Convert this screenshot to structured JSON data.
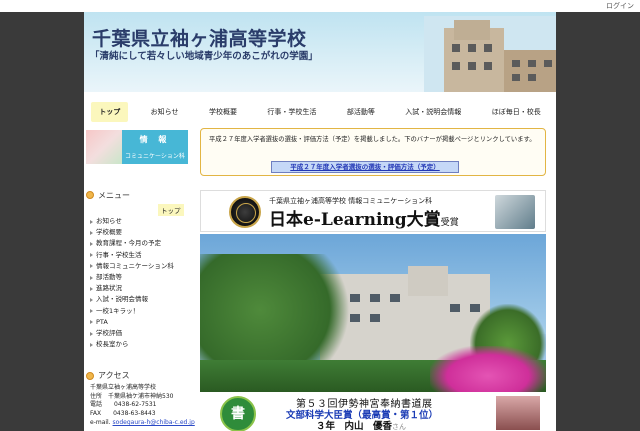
{
  "topbar": {
    "login_label": "ログイン"
  },
  "header": {
    "title": "千葉県立袖ヶ浦高等学校",
    "subtitle": "「清純にして若々しい地域青少年のあこがれの学園」"
  },
  "nav": {
    "items": [
      {
        "label": "トップ",
        "active": true
      },
      {
        "label": "お知らせ"
      },
      {
        "label": "学校概要"
      },
      {
        "label": "行事・学校生活"
      },
      {
        "label": "部活動等"
      },
      {
        "label": "入試・説明会情報"
      },
      {
        "label": "ほぼ毎日・校長"
      }
    ]
  },
  "sidebar": {
    "banner": {
      "line1": "情 報",
      "line2": "コミュニケーション科"
    },
    "menu_title": "メニュー",
    "top_label": "トップ",
    "menu_items": [
      "お知らせ",
      "学校概要",
      "教育課程・今月の予定",
      "行事・学校生活",
      "情報コミュニケーション科",
      "部活動等",
      "進路状況",
      "入試・説明会情報",
      "一校1キラッ！",
      "PTA",
      "学校評価",
      "校長室から"
    ],
    "access": {
      "title": "アクセス",
      "school": "千葉県立袖ヶ浦高等学校",
      "address": "住所　千葉県袖ケ浦市神納530",
      "tel": "電話　　0438-62-7531",
      "fax": "FAX　　0438-63-8443",
      "email_label": "e-mail.",
      "email": "sodegaura-h@chiba-c.ed.jp"
    }
  },
  "main": {
    "notice_text": "平成２７年度入学者選抜の選抜・評価方法（予定）を掲載しました。下のバナーが掲載ページとリンクしています。",
    "notice_button": "平成２７年度入学者選抜の選抜・評価方法（予定）",
    "award": {
      "subtitle": "千葉県立袖ヶ浦高等学校 情報コミュニケーション科",
      "title": "日本e-Learning大賞",
      "title_suffix": "受賞"
    },
    "award2": {
      "badge": "書",
      "line1": "第５３回伊勢神宮奉納書道展",
      "line2": "文部科学大臣賞（最高賞・第１位）",
      "line3": "３年　内山　優香",
      "line3_suffix": "さん"
    }
  }
}
